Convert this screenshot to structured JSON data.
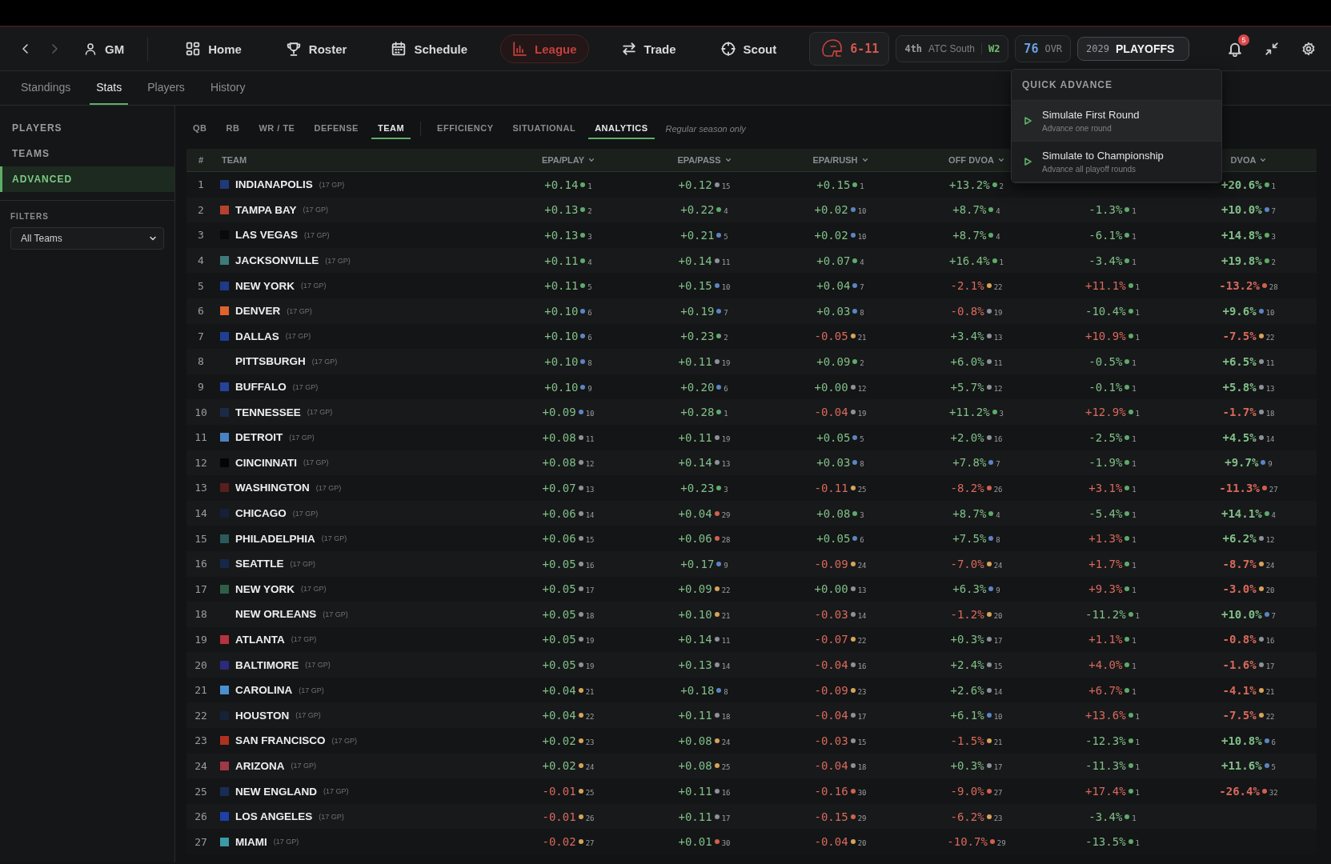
{
  "topbar": {
    "back": {
      "disabled": false
    },
    "forward": {
      "disabled": true
    },
    "profile": "GM",
    "nav": [
      {
        "label": "Home",
        "selected": false
      },
      {
        "label": "Roster",
        "selected": false
      },
      {
        "label": "Schedule",
        "selected": false
      },
      {
        "label": "League",
        "selected": true
      },
      {
        "label": "Trade",
        "selected": false
      },
      {
        "label": "Scout",
        "selected": false
      }
    ],
    "record": "6-11",
    "standing": {
      "place": "4th",
      "division": "ATC South",
      "streak": "W2"
    },
    "rating": {
      "value": "76",
      "label": "OVR"
    },
    "season": {
      "year": "2029",
      "phase": "PLAYOFFS",
      "expanded": true
    },
    "notifications": "5"
  },
  "quick_advance": {
    "title": "QUICK ADVANCE",
    "items": [
      {
        "title": "Simulate First Round",
        "subtitle": "Advance one round",
        "selected": true
      },
      {
        "title": "Simulate to Championship",
        "subtitle": "Advance all playoff rounds",
        "selected": false
      }
    ]
  },
  "subtabs": [
    {
      "label": "Standings",
      "selected": false
    },
    {
      "label": "Stats",
      "selected": true
    },
    {
      "label": "Players",
      "selected": false
    },
    {
      "label": "History",
      "selected": false
    }
  ],
  "sidebar": {
    "items": [
      {
        "label": "PLAYERS",
        "selected": false
      },
      {
        "label": "TEAMS",
        "selected": false
      },
      {
        "label": "ADVANCED",
        "selected": true
      }
    ],
    "filters_label": "FILTERS",
    "team_filter": "All Teams"
  },
  "position_tabs": [
    {
      "label": "QB",
      "selected": false
    },
    {
      "label": "RB",
      "selected": false
    },
    {
      "label": "WR / TE",
      "selected": false
    },
    {
      "label": "DEFENSE",
      "selected": false
    },
    {
      "label": "TEAM",
      "selected": true
    }
  ],
  "view_tabs": [
    {
      "label": "EFFICIENCY",
      "selected": false
    },
    {
      "label": "SITUATIONAL",
      "selected": false
    },
    {
      "label": "ANALYTICS",
      "selected": true
    }
  ],
  "note": "Regular season only",
  "table": {
    "rank_label": "#",
    "team_label": "TEAM",
    "columns": [
      "EPA/PLAY",
      "EPA/PASS",
      "EPA/RUSH",
      "OFF DVOA",
      null,
      "DVOA"
    ],
    "rows": [
      {
        "rank": "1",
        "team": "INDIANAPOLIS",
        "games": "(17 GP)",
        "color": "#1f3a78",
        "cells": [
          {
            "value": "+0.14",
            "rank": "1",
            "favorable": true,
            "color": "#5dab6b"
          },
          {
            "value": "+0.12",
            "rank": "15",
            "favorable": true,
            "color": "#8d9299"
          },
          {
            "value": "+0.15",
            "rank": "1",
            "favorable": true,
            "color": "#5dab6b"
          },
          {
            "value": "+13.2%",
            "rank": "2",
            "favorable": true,
            "color": "#5dab6b"
          },
          null,
          {
            "value": "+20.6%",
            "rank": "1",
            "favorable": true,
            "color": "#5dab6b"
          }
        ]
      },
      {
        "rank": "2",
        "team": "TAMPA BAY",
        "games": "(17 GP)",
        "color": "#b5412f",
        "cells": [
          {
            "value": "+0.13",
            "rank": "2",
            "favorable": true,
            "color": "#5dab6b"
          },
          {
            "value": "+0.22",
            "rank": "4",
            "favorable": true,
            "color": "#5dab6b"
          },
          {
            "value": "+0.02",
            "rank": "10",
            "favorable": true,
            "color": "#5b84c4"
          },
          {
            "value": "+8.7%",
            "rank": "4",
            "favorable": true,
            "color": "#5dab6b"
          },
          {
            "value": "-1.3%",
            "rank": "1",
            "favorable": true,
            "color": "#5dab6b"
          },
          {
            "value": "+10.0%",
            "rank": "7",
            "favorable": true,
            "color": "#5b84c4"
          }
        ]
      },
      {
        "rank": "3",
        "team": "LAS VEGAS",
        "games": "(17 GP)",
        "color": "#0a0a0a",
        "cells": [
          {
            "value": "+0.13",
            "rank": "3",
            "favorable": true,
            "color": "#5dab6b"
          },
          {
            "value": "+0.21",
            "rank": "5",
            "favorable": true,
            "color": "#5b84c4"
          },
          {
            "value": "+0.02",
            "rank": "10",
            "favorable": true,
            "color": "#5b84c4"
          },
          {
            "value": "+8.7%",
            "rank": "4",
            "favorable": true,
            "color": "#5dab6b"
          },
          {
            "value": "-6.1%",
            "rank": "1",
            "favorable": true,
            "color": "#5dab6b"
          },
          {
            "value": "+14.8%",
            "rank": "3",
            "favorable": true,
            "color": "#5dab6b"
          }
        ]
      },
      {
        "rank": "4",
        "team": "JACKSONVILLE",
        "games": "(17 GP)",
        "color": "#3f7a7a",
        "cells": [
          {
            "value": "+0.11",
            "rank": "4",
            "favorable": true,
            "color": "#5dab6b"
          },
          {
            "value": "+0.14",
            "rank": "11",
            "favorable": true,
            "color": "#8d9299"
          },
          {
            "value": "+0.07",
            "rank": "4",
            "favorable": true,
            "color": "#5dab6b"
          },
          {
            "value": "+16.4%",
            "rank": "1",
            "favorable": true,
            "color": "#5dab6b"
          },
          {
            "value": "-3.4%",
            "rank": "1",
            "favorable": true,
            "color": "#5dab6b"
          },
          {
            "value": "+19.8%",
            "rank": "2",
            "favorable": true,
            "color": "#5dab6b"
          }
        ]
      },
      {
        "rank": "5",
        "team": "NEW YORK",
        "games": "(17 GP)",
        "color": "#1f3a8a",
        "cells": [
          {
            "value": "+0.11",
            "rank": "5",
            "favorable": true,
            "color": "#5dab6b"
          },
          {
            "value": "+0.15",
            "rank": "10",
            "favorable": true,
            "color": "#5b84c4"
          },
          {
            "value": "+0.04",
            "rank": "7",
            "favorable": true,
            "color": "#5b84c4"
          },
          {
            "value": "-2.1%",
            "rank": "22",
            "favorable": false,
            "color": "#d8a25a"
          },
          {
            "value": "+11.1%",
            "rank": "1",
            "favorable": false,
            "color": "#5dab6b"
          },
          {
            "value": "-13.2%",
            "rank": "28",
            "favorable": false,
            "color": "#d2604f"
          }
        ]
      },
      {
        "rank": "6",
        "team": "DENVER",
        "games": "(17 GP)",
        "color": "#e0622e",
        "cells": [
          {
            "value": "+0.10",
            "rank": "6",
            "favorable": true,
            "color": "#5b84c4"
          },
          {
            "value": "+0.19",
            "rank": "7",
            "favorable": true,
            "color": "#5b84c4"
          },
          {
            "value": "+0.03",
            "rank": "8",
            "favorable": true,
            "color": "#5b84c4"
          },
          {
            "value": "-0.8%",
            "rank": "19",
            "favorable": false,
            "color": "#8d9299"
          },
          {
            "value": "-10.4%",
            "rank": "1",
            "favorable": true,
            "color": "#5dab6b"
          },
          {
            "value": "+9.6%",
            "rank": "10",
            "favorable": true,
            "color": "#5b84c4"
          }
        ]
      },
      {
        "rank": "7",
        "team": "DALLAS",
        "games": "(17 GP)",
        "color": "#1f3f95",
        "cells": [
          {
            "value": "+0.10",
            "rank": "6",
            "favorable": true,
            "color": "#5b84c4"
          },
          {
            "value": "+0.23",
            "rank": "2",
            "favorable": true,
            "color": "#5dab6b"
          },
          {
            "value": "-0.05",
            "rank": "21",
            "favorable": false,
            "color": "#d8a25a"
          },
          {
            "value": "+3.4%",
            "rank": "13",
            "favorable": true,
            "color": "#8d9299"
          },
          {
            "value": "+10.9%",
            "rank": "1",
            "favorable": false,
            "color": "#5dab6b"
          },
          {
            "value": "-7.5%",
            "rank": "22",
            "favorable": false,
            "color": "#d8a25a"
          }
        ]
      },
      {
        "rank": "8",
        "team": "PITTSBURGH",
        "games": "(17 GP)",
        "cells": [
          {
            "value": "+0.10",
            "rank": "8",
            "favorable": true,
            "color": "#5b84c4"
          },
          {
            "value": "+0.11",
            "rank": "19",
            "favorable": true,
            "color": "#8d9299"
          },
          {
            "value": "+0.09",
            "rank": "2",
            "favorable": true,
            "color": "#5dab6b"
          },
          {
            "value": "+6.0%",
            "rank": "11",
            "favorable": true,
            "color": "#8d9299"
          },
          {
            "value": "-0.5%",
            "rank": "1",
            "favorable": true,
            "color": "#5dab6b"
          },
          {
            "value": "+6.5%",
            "rank": "11",
            "favorable": true,
            "color": "#8d9299"
          }
        ]
      },
      {
        "rank": "9",
        "team": "BUFFALO",
        "games": "(17 GP)",
        "color": "#23449a",
        "cells": [
          {
            "value": "+0.10",
            "rank": "9",
            "favorable": true,
            "color": "#5b84c4"
          },
          {
            "value": "+0.20",
            "rank": "6",
            "favorable": true,
            "color": "#5b84c4"
          },
          {
            "value": "+0.00",
            "rank": "12",
            "favorable": true,
            "color": "#8d9299"
          },
          {
            "value": "+5.7%",
            "rank": "12",
            "favorable": true,
            "color": "#8d9299"
          },
          {
            "value": "-0.1%",
            "rank": "1",
            "favorable": true,
            "color": "#5dab6b"
          },
          {
            "value": "+5.8%",
            "rank": "13",
            "favorable": true,
            "color": "#8d9299"
          }
        ]
      },
      {
        "rank": "10",
        "team": "TENNESSEE",
        "games": "(17 GP)",
        "color": "#1c2a48",
        "cells": [
          {
            "value": "+0.09",
            "rank": "10",
            "favorable": true,
            "color": "#5b84c4"
          },
          {
            "value": "+0.28",
            "rank": "1",
            "favorable": true,
            "color": "#5dab6b"
          },
          {
            "value": "-0.04",
            "rank": "19",
            "favorable": false,
            "color": "#8d9299"
          },
          {
            "value": "+11.2%",
            "rank": "3",
            "favorable": true,
            "color": "#5dab6b"
          },
          {
            "value": "+12.9%",
            "rank": "1",
            "favorable": false,
            "color": "#5dab6b"
          },
          {
            "value": "-1.7%",
            "rank": "18",
            "favorable": false,
            "color": "#8d9299"
          }
        ]
      },
      {
        "rank": "11",
        "team": "DETROIT",
        "games": "(17 GP)",
        "color": "#4a82c4",
        "cells": [
          {
            "value": "+0.08",
            "rank": "11",
            "favorable": true,
            "color": "#8d9299"
          },
          {
            "value": "+0.11",
            "rank": "19",
            "favorable": true,
            "color": "#8d9299"
          },
          {
            "value": "+0.05",
            "rank": "5",
            "favorable": true,
            "color": "#5b84c4"
          },
          {
            "value": "+2.0%",
            "rank": "16",
            "favorable": true,
            "color": "#8d9299"
          },
          {
            "value": "-2.5%",
            "rank": "1",
            "favorable": true,
            "color": "#5dab6b"
          },
          {
            "value": "+4.5%",
            "rank": "14",
            "favorable": true,
            "color": "#8d9299"
          }
        ]
      },
      {
        "rank": "12",
        "team": "CINCINNATI",
        "games": "(17 GP)",
        "color": "#050505",
        "cells": [
          {
            "value": "+0.08",
            "rank": "12",
            "favorable": true,
            "color": "#8d9299"
          },
          {
            "value": "+0.14",
            "rank": "13",
            "favorable": true,
            "color": "#8d9299"
          },
          {
            "value": "+0.03",
            "rank": "8",
            "favorable": true,
            "color": "#5b84c4"
          },
          {
            "value": "+7.8%",
            "rank": "7",
            "favorable": true,
            "color": "#5b84c4"
          },
          {
            "value": "-1.9%",
            "rank": "1",
            "favorable": true,
            "color": "#5dab6b"
          },
          {
            "value": "+9.7%",
            "rank": "9",
            "favorable": true,
            "color": "#5b84c4"
          }
        ]
      },
      {
        "rank": "13",
        "team": "WASHINGTON",
        "games": "(17 GP)",
        "color": "#5a1e1e",
        "cells": [
          {
            "value": "+0.07",
            "rank": "13",
            "favorable": true,
            "color": "#8d9299"
          },
          {
            "value": "+0.23",
            "rank": "3",
            "favorable": true,
            "color": "#5dab6b"
          },
          {
            "value": "-0.11",
            "rank": "25",
            "favorable": false,
            "color": "#d8a25a"
          },
          {
            "value": "-8.2%",
            "rank": "26",
            "favorable": false,
            "color": "#d2604f"
          },
          {
            "value": "+3.1%",
            "rank": "1",
            "favorable": false,
            "color": "#5dab6b"
          },
          {
            "value": "-11.3%",
            "rank": "27",
            "favorable": false,
            "color": "#d2604f"
          }
        ]
      },
      {
        "rank": "14",
        "team": "CHICAGO",
        "games": "(17 GP)",
        "color": "#16203a",
        "cells": [
          {
            "value": "+0.06",
            "rank": "14",
            "favorable": true,
            "color": "#8d9299"
          },
          {
            "value": "+0.04",
            "rank": "29",
            "favorable": true,
            "color": "#d2604f"
          },
          {
            "value": "+0.08",
            "rank": "3",
            "favorable": true,
            "color": "#5dab6b"
          },
          {
            "value": "+8.7%",
            "rank": "4",
            "favorable": true,
            "color": "#5dab6b"
          },
          {
            "value": "-5.4%",
            "rank": "1",
            "favorable": true,
            "color": "#5dab6b"
          },
          {
            "value": "+14.1%",
            "rank": "4",
            "favorable": true,
            "color": "#5dab6b"
          }
        ]
      },
      {
        "rank": "15",
        "team": "PHILADELPHIA",
        "games": "(17 GP)",
        "color": "#2a5a5a",
        "cells": [
          {
            "value": "+0.06",
            "rank": "15",
            "favorable": true,
            "color": "#8d9299"
          },
          {
            "value": "+0.06",
            "rank": "28",
            "favorable": true,
            "color": "#d2604f"
          },
          {
            "value": "+0.05",
            "rank": "6",
            "favorable": true,
            "color": "#5b84c4"
          },
          {
            "value": "+7.5%",
            "rank": "8",
            "favorable": true,
            "color": "#5b84c4"
          },
          {
            "value": "+1.3%",
            "rank": "1",
            "favorable": false,
            "color": "#5dab6b"
          },
          {
            "value": "+6.2%",
            "rank": "12",
            "favorable": true,
            "color": "#8d9299"
          }
        ]
      },
      {
        "rank": "16",
        "team": "SEATTLE",
        "games": "(17 GP)",
        "color": "#15284a",
        "cells": [
          {
            "value": "+0.05",
            "rank": "16",
            "favorable": true,
            "color": "#8d9299"
          },
          {
            "value": "+0.17",
            "rank": "9",
            "favorable": true,
            "color": "#5b84c4"
          },
          {
            "value": "-0.09",
            "rank": "24",
            "favorable": false,
            "color": "#d8a25a"
          },
          {
            "value": "-7.0%",
            "rank": "24",
            "favorable": false,
            "color": "#d8a25a"
          },
          {
            "value": "+1.7%",
            "rank": "1",
            "favorable": false,
            "color": "#5dab6b"
          },
          {
            "value": "-8.7%",
            "rank": "24",
            "favorable": false,
            "color": "#d8a25a"
          }
        ]
      },
      {
        "rank": "17",
        "team": "NEW YORK",
        "games": "(17 GP)",
        "color": "#2e5e48",
        "cells": [
          {
            "value": "+0.05",
            "rank": "17",
            "favorable": true,
            "color": "#8d9299"
          },
          {
            "value": "+0.09",
            "rank": "22",
            "favorable": true,
            "color": "#d8a25a"
          },
          {
            "value": "+0.00",
            "rank": "13",
            "favorable": true,
            "color": "#8d9299"
          },
          {
            "value": "+6.3%",
            "rank": "9",
            "favorable": true,
            "color": "#5b84c4"
          },
          {
            "value": "+9.3%",
            "rank": "1",
            "favorable": false,
            "color": "#5dab6b"
          },
          {
            "value": "-3.0%",
            "rank": "20",
            "favorable": false,
            "color": "#d8a25a"
          }
        ]
      },
      {
        "rank": "18",
        "team": "NEW ORLEANS",
        "games": "(17 GP)",
        "cells": [
          {
            "value": "+0.05",
            "rank": "18",
            "favorable": true,
            "color": "#8d9299"
          },
          {
            "value": "+0.10",
            "rank": "21",
            "favorable": true,
            "color": "#d8a25a"
          },
          {
            "value": "-0.03",
            "rank": "14",
            "favorable": false,
            "color": "#8d9299"
          },
          {
            "value": "-1.2%",
            "rank": "20",
            "favorable": false,
            "color": "#d8a25a"
          },
          {
            "value": "-11.2%",
            "rank": "1",
            "favorable": true,
            "color": "#5dab6b"
          },
          {
            "value": "+10.0%",
            "rank": "7",
            "favorable": true,
            "color": "#5b84c4"
          }
        ]
      },
      {
        "rank": "19",
        "team": "ATLANTA",
        "games": "(17 GP)",
        "color": "#b5333c",
        "cells": [
          {
            "value": "+0.05",
            "rank": "19",
            "favorable": true,
            "color": "#8d9299"
          },
          {
            "value": "+0.14",
            "rank": "11",
            "favorable": true,
            "color": "#8d9299"
          },
          {
            "value": "-0.07",
            "rank": "22",
            "favorable": false,
            "color": "#d8a25a"
          },
          {
            "value": "+0.3%",
            "rank": "17",
            "favorable": true,
            "color": "#8d9299"
          },
          {
            "value": "+1.1%",
            "rank": "1",
            "favorable": false,
            "color": "#5dab6b"
          },
          {
            "value": "-0.8%",
            "rank": "16",
            "favorable": false,
            "color": "#8d9299"
          }
        ]
      },
      {
        "rank": "20",
        "team": "BALTIMORE",
        "games": "(17 GP)",
        "color": "#2c2a7a",
        "cells": [
          {
            "value": "+0.05",
            "rank": "19",
            "favorable": true,
            "color": "#8d9299"
          },
          {
            "value": "+0.13",
            "rank": "14",
            "favorable": true,
            "color": "#8d9299"
          },
          {
            "value": "-0.04",
            "rank": "16",
            "favorable": false,
            "color": "#8d9299"
          },
          {
            "value": "+2.4%",
            "rank": "15",
            "favorable": true,
            "color": "#8d9299"
          },
          {
            "value": "+4.0%",
            "rank": "1",
            "favorable": false,
            "color": "#5dab6b"
          },
          {
            "value": "-1.6%",
            "rank": "17",
            "favorable": false,
            "color": "#8d9299"
          }
        ]
      },
      {
        "rank": "21",
        "team": "CAROLINA",
        "games": "(17 GP)",
        "color": "#4a90d0",
        "cells": [
          {
            "value": "+0.04",
            "rank": "21",
            "favorable": true,
            "color": "#d8a25a"
          },
          {
            "value": "+0.18",
            "rank": "8",
            "favorable": true,
            "color": "#5b84c4"
          },
          {
            "value": "-0.09",
            "rank": "23",
            "favorable": false,
            "color": "#d8a25a"
          },
          {
            "value": "+2.6%",
            "rank": "14",
            "favorable": true,
            "color": "#8d9299"
          },
          {
            "value": "+6.7%",
            "rank": "1",
            "favorable": false,
            "color": "#5dab6b"
          },
          {
            "value": "-4.1%",
            "rank": "21",
            "favorable": false,
            "color": "#d8a25a"
          }
        ]
      },
      {
        "rank": "22",
        "team": "HOUSTON",
        "games": "(17 GP)",
        "color": "#152238",
        "cells": [
          {
            "value": "+0.04",
            "rank": "22",
            "favorable": true,
            "color": "#d8a25a"
          },
          {
            "value": "+0.11",
            "rank": "18",
            "favorable": true,
            "color": "#8d9299"
          },
          {
            "value": "-0.04",
            "rank": "17",
            "favorable": false,
            "color": "#8d9299"
          },
          {
            "value": "+6.1%",
            "rank": "10",
            "favorable": true,
            "color": "#5b84c4"
          },
          {
            "value": "+13.6%",
            "rank": "1",
            "favorable": false,
            "color": "#5dab6b"
          },
          {
            "value": "-7.5%",
            "rank": "22",
            "favorable": false,
            "color": "#d8a25a"
          }
        ]
      },
      {
        "rank": "23",
        "team": "SAN FRANCISCO",
        "games": "(17 GP)",
        "color": "#b03020",
        "cells": [
          {
            "value": "+0.02",
            "rank": "23",
            "favorable": true,
            "color": "#d8a25a"
          },
          {
            "value": "+0.08",
            "rank": "24",
            "favorable": true,
            "color": "#d8a25a"
          },
          {
            "value": "-0.03",
            "rank": "15",
            "favorable": false,
            "color": "#8d9299"
          },
          {
            "value": "-1.5%",
            "rank": "21",
            "favorable": false,
            "color": "#d8a25a"
          },
          {
            "value": "-12.3%",
            "rank": "1",
            "favorable": true,
            "color": "#5dab6b"
          },
          {
            "value": "+10.8%",
            "rank": "6",
            "favorable": true,
            "color": "#5b84c4"
          }
        ]
      },
      {
        "rank": "24",
        "team": "ARIZONA",
        "games": "(17 GP)",
        "color": "#a03845",
        "cells": [
          {
            "value": "+0.02",
            "rank": "24",
            "favorable": true,
            "color": "#d8a25a"
          },
          {
            "value": "+0.08",
            "rank": "25",
            "favorable": true,
            "color": "#d8a25a"
          },
          {
            "value": "-0.04",
            "rank": "18",
            "favorable": false,
            "color": "#8d9299"
          },
          {
            "value": "+0.3%",
            "rank": "17",
            "favorable": true,
            "color": "#8d9299"
          },
          {
            "value": "-11.3%",
            "rank": "1",
            "favorable": true,
            "color": "#5dab6b"
          },
          {
            "value": "+11.6%",
            "rank": "5",
            "favorable": true,
            "color": "#5b84c4"
          }
        ]
      },
      {
        "rank": "25",
        "team": "NEW ENGLAND",
        "games": "(17 GP)",
        "color": "#182c55",
        "cells": [
          {
            "value": "-0.01",
            "rank": "25",
            "favorable": false,
            "color": "#d8a25a"
          },
          {
            "value": "+0.11",
            "rank": "16",
            "favorable": true,
            "color": "#8d9299"
          },
          {
            "value": "-0.16",
            "rank": "30",
            "favorable": false,
            "color": "#d2604f"
          },
          {
            "value": "-9.0%",
            "rank": "27",
            "favorable": false,
            "color": "#d2604f"
          },
          {
            "value": "+17.4%",
            "rank": "1",
            "favorable": false,
            "color": "#5dab6b"
          },
          {
            "value": "-26.4%",
            "rank": "32",
            "favorable": false,
            "color": "#d2604f"
          }
        ]
      },
      {
        "rank": "26",
        "team": "LOS ANGELES",
        "games": "(17 GP)",
        "color": "#1e40a8",
        "cells": [
          {
            "value": "-0.01",
            "rank": "26",
            "favorable": false,
            "color": "#d8a25a"
          },
          {
            "value": "+0.11",
            "rank": "17",
            "favorable": true,
            "color": "#8d9299"
          },
          {
            "value": "-0.15",
            "rank": "29",
            "favorable": false,
            "color": "#d2604f"
          },
          {
            "value": "-6.2%",
            "rank": "23",
            "favorable": false,
            "color": "#d8a25a"
          },
          {
            "value": "-3.4%",
            "rank": "1",
            "favorable": true,
            "color": "#5dab6b"
          },
          null
        ]
      },
      {
        "rank": "27",
        "team": "MIAMI",
        "games": "(17 GP)",
        "color": "#3a9aa5",
        "cells": [
          {
            "value": "-0.02",
            "rank": "27",
            "favorable": false,
            "color": "#d8a25a"
          },
          {
            "value": "+0.01",
            "rank": "30",
            "favorable": true,
            "color": "#d2604f"
          },
          {
            "value": "-0.04",
            "rank": "20",
            "favorable": false,
            "color": "#d8a25a"
          },
          {
            "value": "-10.7%",
            "rank": "29",
            "favorable": false,
            "color": "#d2604f"
          },
          {
            "value": "-13.5%",
            "rank": "1",
            "favorable": true,
            "color": "#5dab6b"
          },
          null
        ]
      }
    ]
  }
}
